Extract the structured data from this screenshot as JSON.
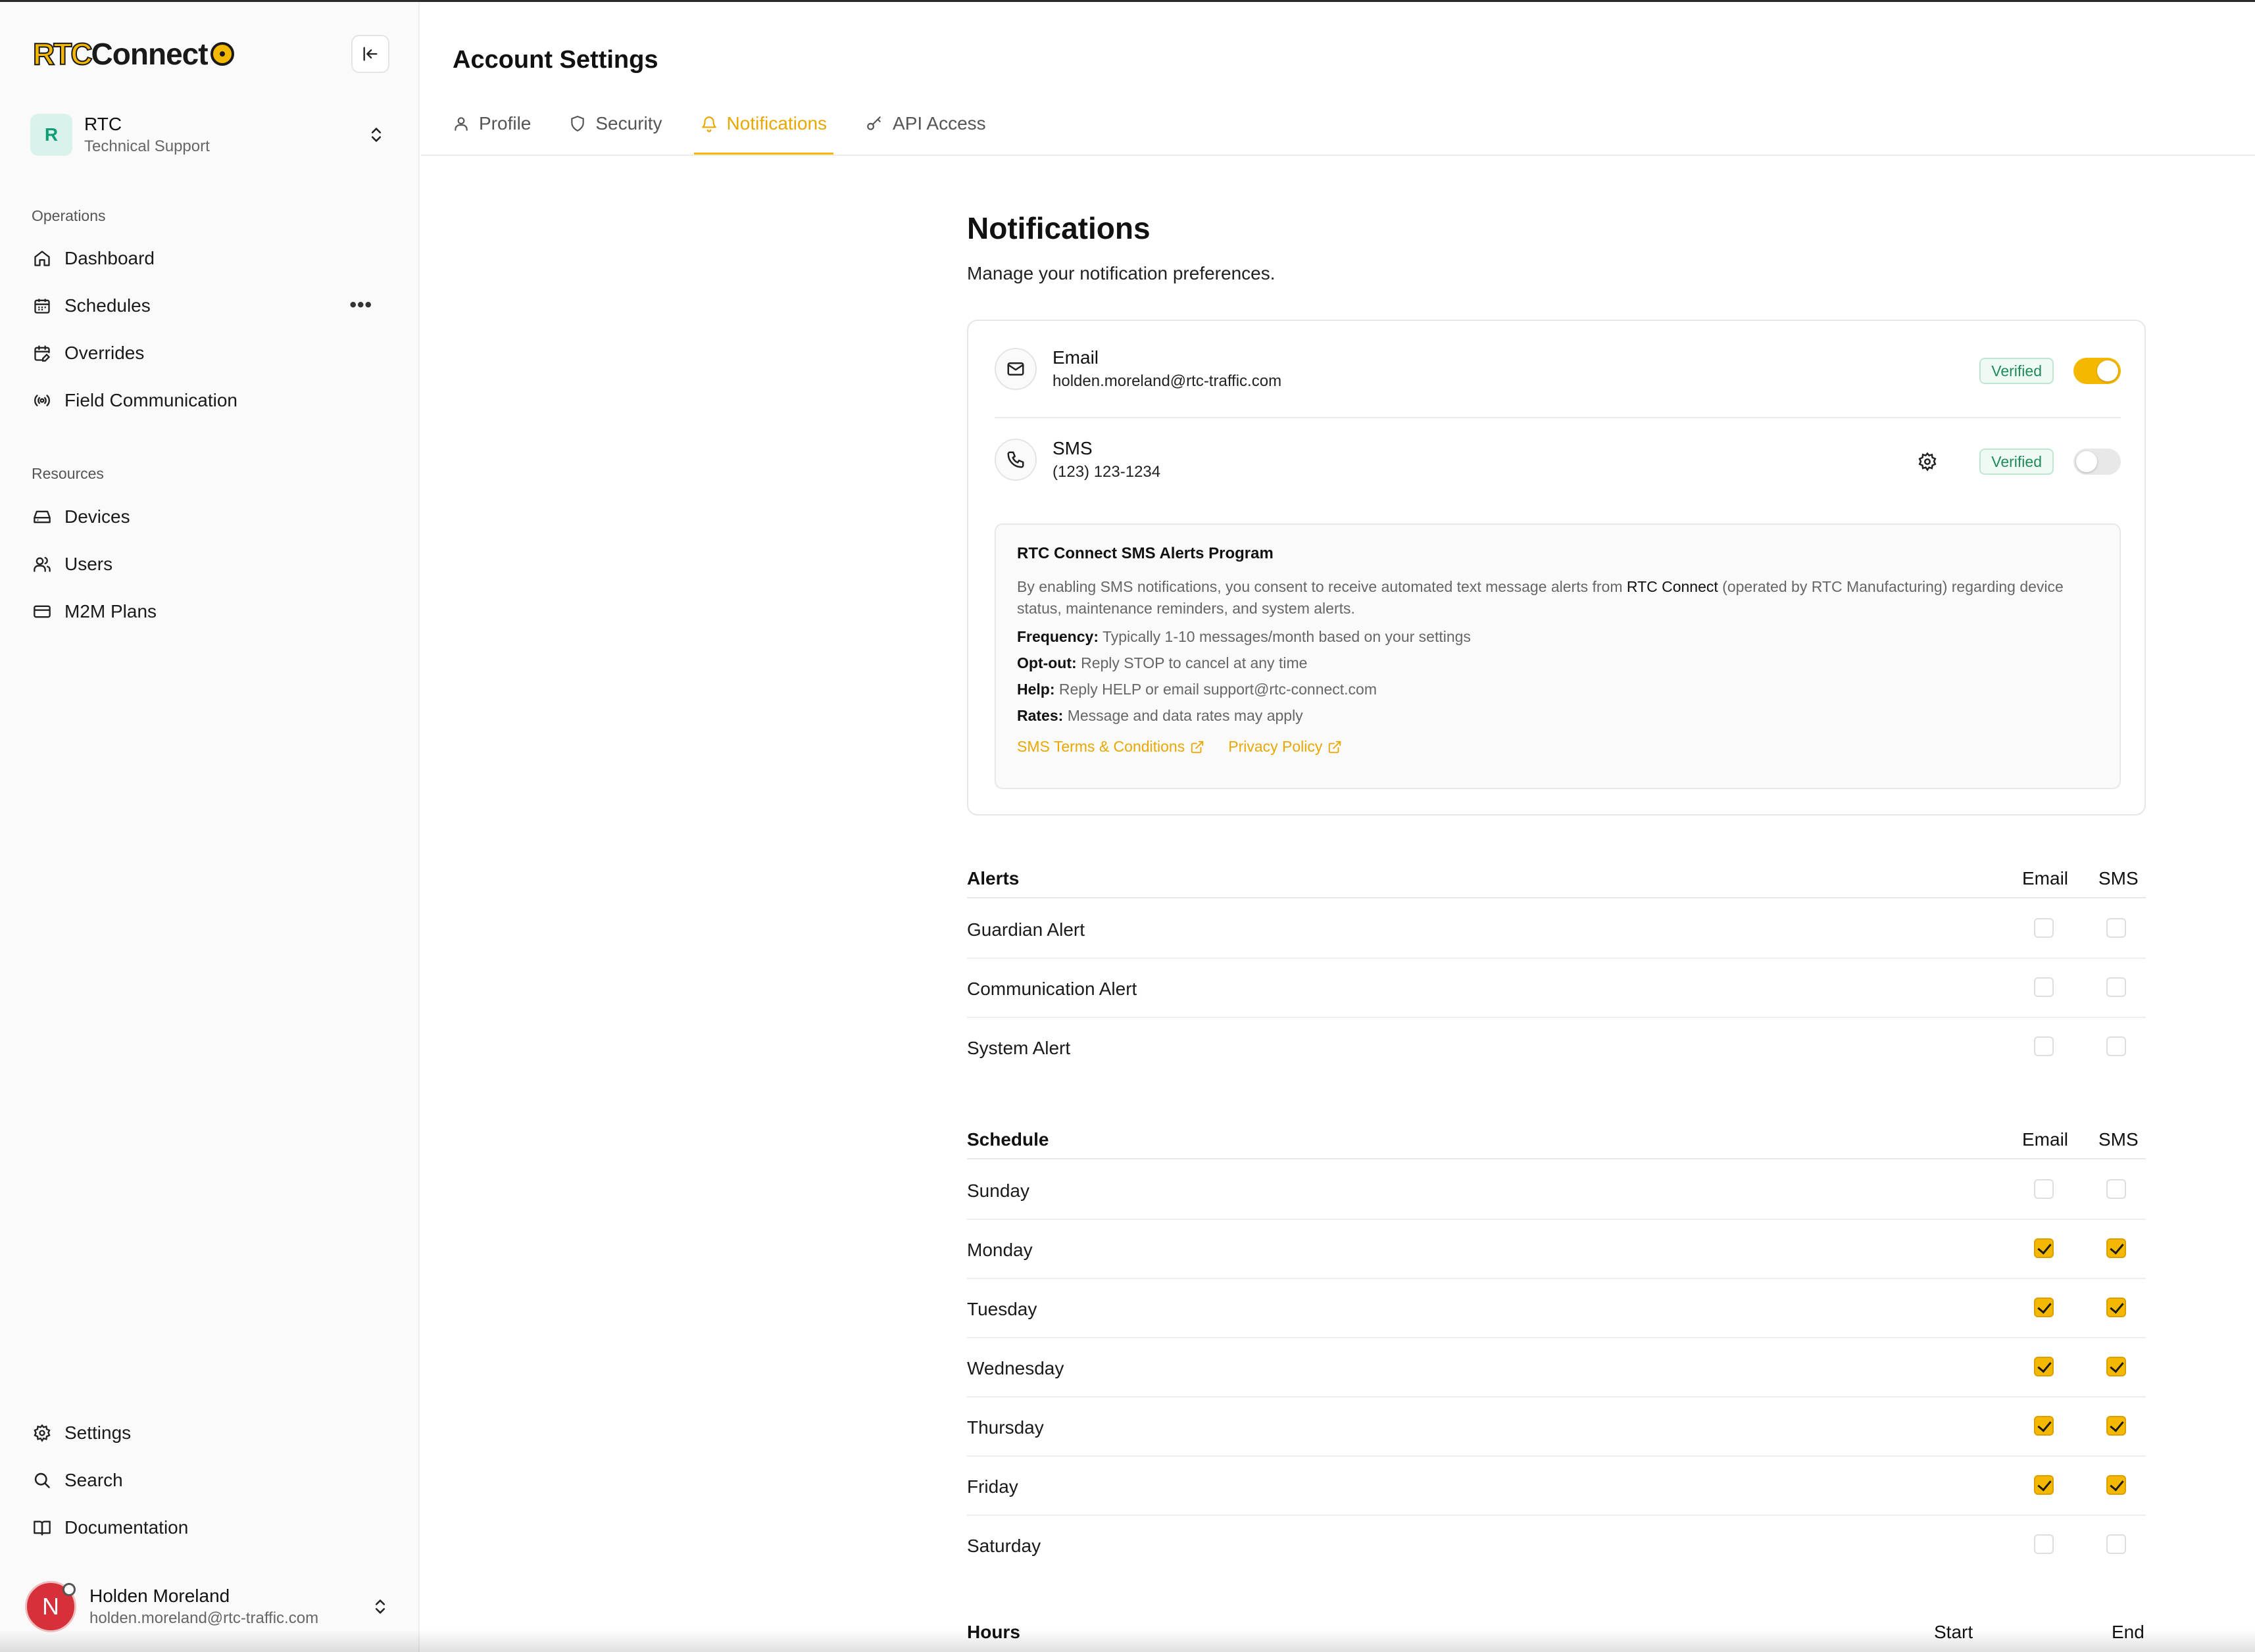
{
  "brand": {
    "logo_rtc": "RTC",
    "logo_connect": "Connect",
    "accent": "#f5b800"
  },
  "org": {
    "avatar": "R",
    "name": "RTC",
    "subtitle": "Technical Support"
  },
  "sidebar": {
    "operations_label": "Operations",
    "operations": [
      {
        "label": "Dashboard",
        "icon": "home-icon"
      },
      {
        "label": "Schedules",
        "icon": "calendar-icon"
      },
      {
        "label": "Overrides",
        "icon": "calendar-edit-icon"
      },
      {
        "label": "Field Communication",
        "icon": "radio-icon"
      }
    ],
    "schedules_more": "•••",
    "resources_label": "Resources",
    "resources": [
      {
        "label": "Devices",
        "icon": "hard-drive-icon"
      },
      {
        "label": "Users",
        "icon": "users-icon"
      },
      {
        "label": "M2M Plans",
        "icon": "card-icon"
      }
    ],
    "footer": [
      {
        "label": "Settings",
        "icon": "gear-icon"
      },
      {
        "label": "Search",
        "icon": "search-icon"
      },
      {
        "label": "Documentation",
        "icon": "book-icon"
      }
    ]
  },
  "user": {
    "avatar": "N",
    "name": "Holden Moreland",
    "email": "holden.moreland@rtc-traffic.com"
  },
  "page": {
    "title": "Account Settings",
    "tabs": [
      {
        "label": "Profile",
        "icon": "user-icon"
      },
      {
        "label": "Security",
        "icon": "shield-icon"
      },
      {
        "label": "Notifications",
        "icon": "bell-icon",
        "active": true
      },
      {
        "label": "API Access",
        "icon": "key-icon"
      }
    ]
  },
  "notifications": {
    "heading": "Notifications",
    "subtitle": "Manage your notification preferences.",
    "email": {
      "title": "Email",
      "value": "holden.moreland@rtc-traffic.com",
      "status": "Verified",
      "enabled": true
    },
    "sms": {
      "title": "SMS",
      "value": "(123) 123-1234",
      "status": "Verified",
      "enabled": false
    },
    "program": {
      "title": "RTC Connect SMS Alerts Program",
      "body_pre": "By enabling SMS notifications, you consent to receive automated text message alerts from ",
      "body_brand": "RTC Connect",
      "body_post": " (operated by RTC Manufacturing) regarding device status, maintenance reminders, and system alerts.",
      "frequency_label": "Frequency:",
      "frequency": " Typically 1-10 messages/month based on your settings",
      "optout_label": "Opt-out:",
      "optout": " Reply STOP to cancel at any time",
      "help_label": "Help:",
      "help": " Reply HELP or email support@rtc-connect.com",
      "rates_label": "Rates:",
      "rates": " Message and data rates may apply",
      "terms_link": "SMS Terms & Conditions",
      "privacy_link": "Privacy Policy"
    },
    "alerts": {
      "title": "Alerts",
      "col_email": "Email",
      "col_sms": "SMS",
      "rows": [
        {
          "label": "Guardian Alert",
          "email": false,
          "sms": false
        },
        {
          "label": "Communication Alert",
          "email": false,
          "sms": false
        },
        {
          "label": "System Alert",
          "email": false,
          "sms": false
        }
      ]
    },
    "schedule": {
      "title": "Schedule",
      "col_email": "Email",
      "col_sms": "SMS",
      "rows": [
        {
          "label": "Sunday",
          "email": false,
          "sms": false
        },
        {
          "label": "Monday",
          "email": true,
          "sms": true
        },
        {
          "label": "Tuesday",
          "email": true,
          "sms": true
        },
        {
          "label": "Wednesday",
          "email": true,
          "sms": true
        },
        {
          "label": "Thursday",
          "email": true,
          "sms": true
        },
        {
          "label": "Friday",
          "email": true,
          "sms": true
        },
        {
          "label": "Saturday",
          "email": false,
          "sms": false
        }
      ]
    },
    "hours": {
      "title": "Hours",
      "col_start": "Start",
      "col_end": "End"
    }
  }
}
